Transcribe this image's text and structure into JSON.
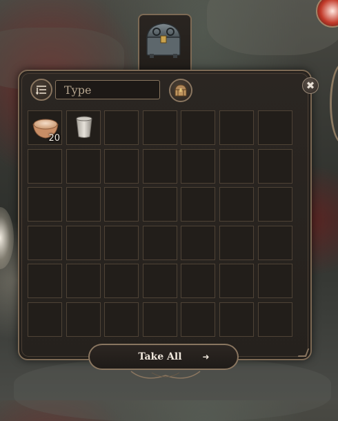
{
  "container": {
    "icon": "chest-icon",
    "search_placeholder": "Type",
    "filter_icon": "filter-sort-icon",
    "sort_icon": "chest-sort-icon",
    "close_label": "✖"
  },
  "items": [
    {
      "slot": 0,
      "icon": "wooden-bowl-icon",
      "quantity": "20"
    },
    {
      "slot": 1,
      "icon": "cup-icon",
      "quantity": ""
    }
  ],
  "grid": {
    "columns": 7,
    "rows": 6
  },
  "footer": {
    "take_all_label": "Take All",
    "take_all_arrow": "➜"
  },
  "colors": {
    "frame": "#7d6a55",
    "panel": "#25211d",
    "slot_border": "#4f4336",
    "text": "#efe7dc"
  }
}
